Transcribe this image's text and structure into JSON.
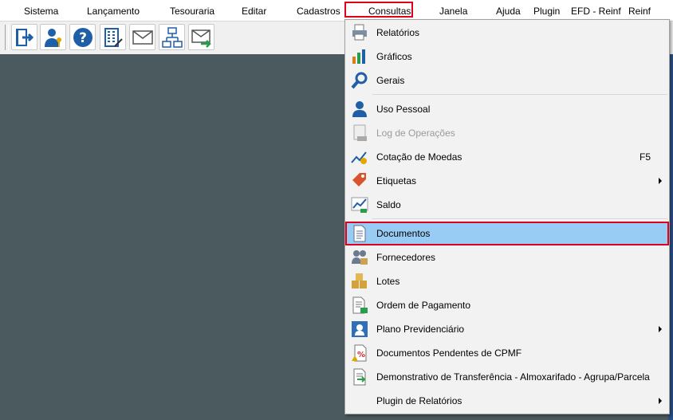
{
  "menubar": {
    "items": [
      "Sistema",
      "Lançamento",
      "Tesouraria",
      "Editar",
      "Cadastros",
      "Consultas",
      "Janela",
      "Ajuda",
      "Plugin",
      "EFD - Reinf",
      "Reinf"
    ],
    "active": "Consultas"
  },
  "toolbar": {
    "buttons": [
      "exit-icon",
      "user-key-icon",
      "help-icon",
      "building-edit-icon",
      "mail-icon",
      "network-icon",
      "mail-forward-icon"
    ]
  },
  "consultas_menu": {
    "items": [
      {
        "label": "Relatórios",
        "icon": "printer-icon"
      },
      {
        "label": "Gráficos",
        "icon": "bar-chart-icon"
      },
      {
        "label": "Gerais",
        "icon": "magnifier-icon"
      },
      {
        "label": "Uso Pessoal",
        "icon": "person-icon"
      },
      {
        "label": "Log de Operações",
        "icon": "log-icon",
        "disabled": true
      },
      {
        "label": "Cotação de Moedas",
        "icon": "currency-chart-icon",
        "shortcut": "F5"
      },
      {
        "label": "Etiquetas",
        "icon": "tag-icon",
        "submenu": true
      },
      {
        "label": "Saldo",
        "icon": "balance-icon"
      },
      {
        "label": "Documentos",
        "icon": "document-icon",
        "selected": true
      },
      {
        "label": "Fornecedores",
        "icon": "suppliers-icon"
      },
      {
        "label": "Lotes",
        "icon": "boxes-icon"
      },
      {
        "label": "Ordem de Pagamento",
        "icon": "payment-order-icon"
      },
      {
        "label": "Plano Previdenciário",
        "icon": "pension-icon",
        "submenu": true
      },
      {
        "label": "Documentos Pendentes de CPMF",
        "icon": "pending-docs-icon"
      },
      {
        "label": "Demonstrativo de Transferência - Almoxarifado - Agrupa/Parcela",
        "icon": "transfer-icon"
      },
      {
        "label": "Plugin de Relatórios",
        "icon": "",
        "submenu": true
      }
    ]
  },
  "colors": {
    "highlight_border": "#e0001b",
    "selected_bg": "#99ccf5",
    "desktop": "#4b5a5f"
  }
}
